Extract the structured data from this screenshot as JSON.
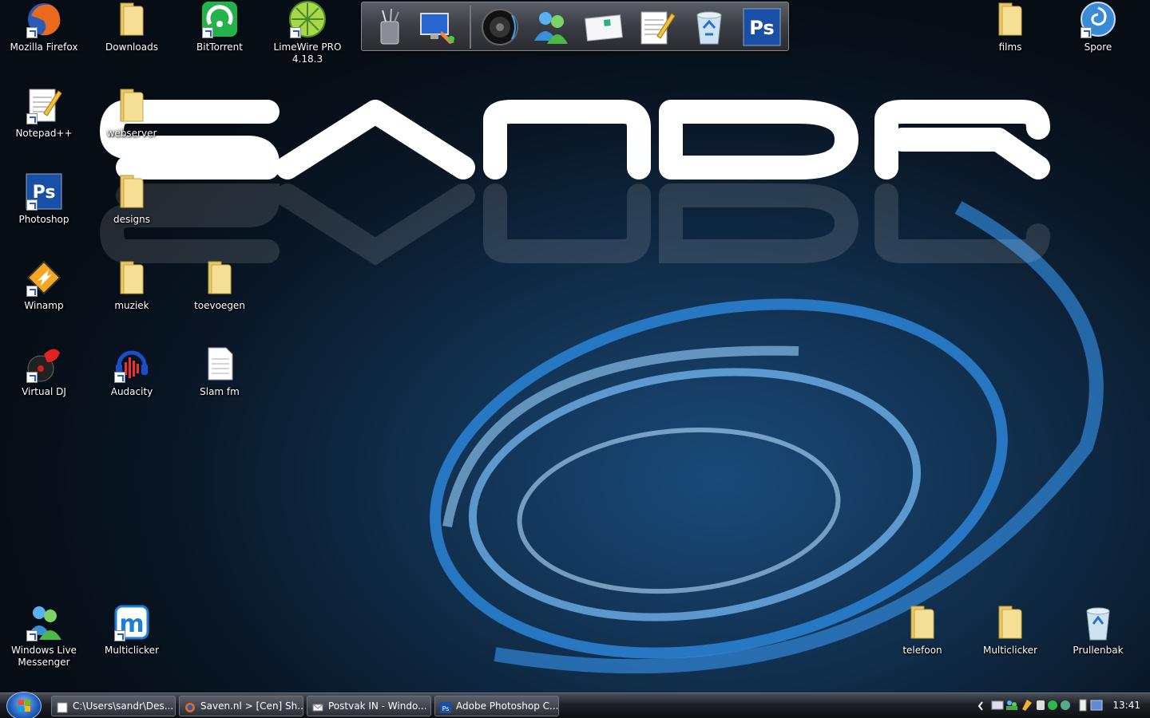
{
  "wallpaper": {
    "brand_text": "SANDR"
  },
  "dock": {
    "items": [
      "pencil-cup-icon",
      "display-settings-icon",
      "speaker-icon",
      "people-icon",
      "mail-icon",
      "notepad-icon",
      "recycle-bin-icon",
      "photoshop-icon"
    ]
  },
  "desktop": {
    "icons": [
      {
        "label": "Mozilla Firefox",
        "icon": "firefox-icon"
      },
      {
        "label": "Downloads",
        "icon": "folder-icon"
      },
      {
        "label": "BitTorrent",
        "icon": "bittorrent-icon"
      },
      {
        "label": "LimeWire PRO 4.18.3",
        "icon": "limewire-icon"
      },
      {
        "label": "films",
        "icon": "folder-icon"
      },
      {
        "label": "Spore",
        "icon": "spore-icon"
      },
      {
        "label": "Notepad++",
        "icon": "notepad-icon"
      },
      {
        "label": "webserver",
        "icon": "folder-icon"
      },
      {
        "label": "Photoshop",
        "icon": "photoshop-icon"
      },
      {
        "label": "designs",
        "icon": "folder-icon"
      },
      {
        "label": "Winamp",
        "icon": "winamp-icon"
      },
      {
        "label": "muziek",
        "icon": "folder-icon"
      },
      {
        "label": "toevoegen",
        "icon": "folder-icon"
      },
      {
        "label": "Virtual DJ",
        "icon": "virtualdj-icon"
      },
      {
        "label": "Audacity",
        "icon": "audacity-icon"
      },
      {
        "label": "Slam fm",
        "icon": "document-icon"
      },
      {
        "label": "Windows Live Messenger",
        "icon": "messenger-icon"
      },
      {
        "label": "Multiclicker",
        "icon": "multiclicker-icon"
      },
      {
        "label": "telefoon",
        "icon": "folder-icon"
      },
      {
        "label": "Multiclicker",
        "icon": "folder-icon"
      },
      {
        "label": "Prullenbak",
        "icon": "recycle-bin-icon"
      }
    ]
  },
  "taskbar": {
    "tasks": [
      {
        "label": "C:\\Users\\sandr\\Des...",
        "icon": "notepad-icon"
      },
      {
        "label": "Saven.nl > [Cen] Sh...",
        "icon": "firefox-icon"
      },
      {
        "label": "Postvak IN - Windo...",
        "icon": "mail-icon"
      },
      {
        "label": "Adobe Photoshop C...",
        "icon": "photoshop-icon"
      }
    ],
    "clock": "13:41",
    "tray_icons": [
      "chevron-left-icon",
      "keyboard-icon",
      "messenger-icon",
      "winamp-icon",
      "usb-icon",
      "bittorrent-icon",
      "limewire-icon",
      "power-icon",
      "network-icon"
    ]
  },
  "colors": {
    "accent": "#1e5bb8",
    "taskbar": "#1d2127",
    "swirl": "#3a9cff"
  }
}
